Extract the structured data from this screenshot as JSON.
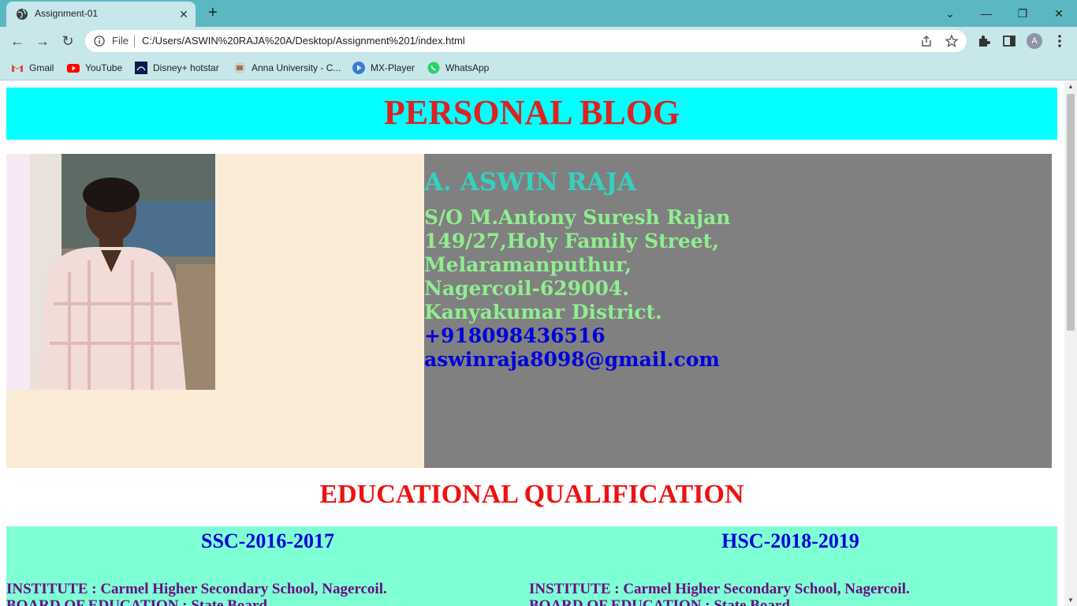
{
  "browser": {
    "tab_title": "Assignment-01",
    "url_scheme_label": "File",
    "url": "C:/Users/ASWIN%20RAJA%20A/Desktop/Assignment%201/index.html",
    "profile_initial": "A",
    "bookmarks": [
      {
        "label": "Gmail",
        "icon": "gmail-icon",
        "color": "#ea4335"
      },
      {
        "label": "YouTube",
        "icon": "youtube-icon",
        "color": "#ff0000"
      },
      {
        "label": "Disney+ hotstar",
        "icon": "hotstar-icon",
        "color": "#0c1b4d"
      },
      {
        "label": "Anna University - C...",
        "icon": "anna-university-icon",
        "color": "#8a7a6a"
      },
      {
        "label": "MX-Player",
        "icon": "mx-player-icon",
        "color": "#3a7bd5"
      },
      {
        "label": "WhatsApp",
        "icon": "whatsapp-icon",
        "color": "#25d366"
      }
    ]
  },
  "page": {
    "header_title": "PERSONAL BLOG",
    "profile": {
      "name": "A. ASWIN RAJA",
      "address_lines": [
        "S/O M.Antony Suresh Rajan",
        "149/27,Holy Family Street,",
        "Melaramanputhur,",
        "Nagercoil-629004.",
        "Kanyakumar District."
      ],
      "phone": "+918098436516",
      "email": "aswinraja8098@gmail.com"
    },
    "education": {
      "title": "EDUCATIONAL QUALIFICATION",
      "ssc": {
        "heading": "SSC-2016-2017",
        "institute": "INSTITUTE : Carmel Higher Secondary School, Nagercoil.",
        "board": "BOARD OF EDUCATION : State Board"
      },
      "hsc": {
        "heading": "HSC-2018-2019",
        "institute": "INSTITUTE : Carmel Higher Secondary School, Nagercoil.",
        "board": "BOARD OF EDUCATION : State Board"
      }
    }
  },
  "colors": {
    "header_bg": "#00ffff",
    "header_text": "#dd2222",
    "photo_panel_bg": "#faebd7",
    "info_panel_bg": "#808080",
    "name_color": "#35d1c0",
    "address_color": "#90ee90",
    "contact_color": "#0000dd",
    "edu_bg": "#7fffd4"
  }
}
